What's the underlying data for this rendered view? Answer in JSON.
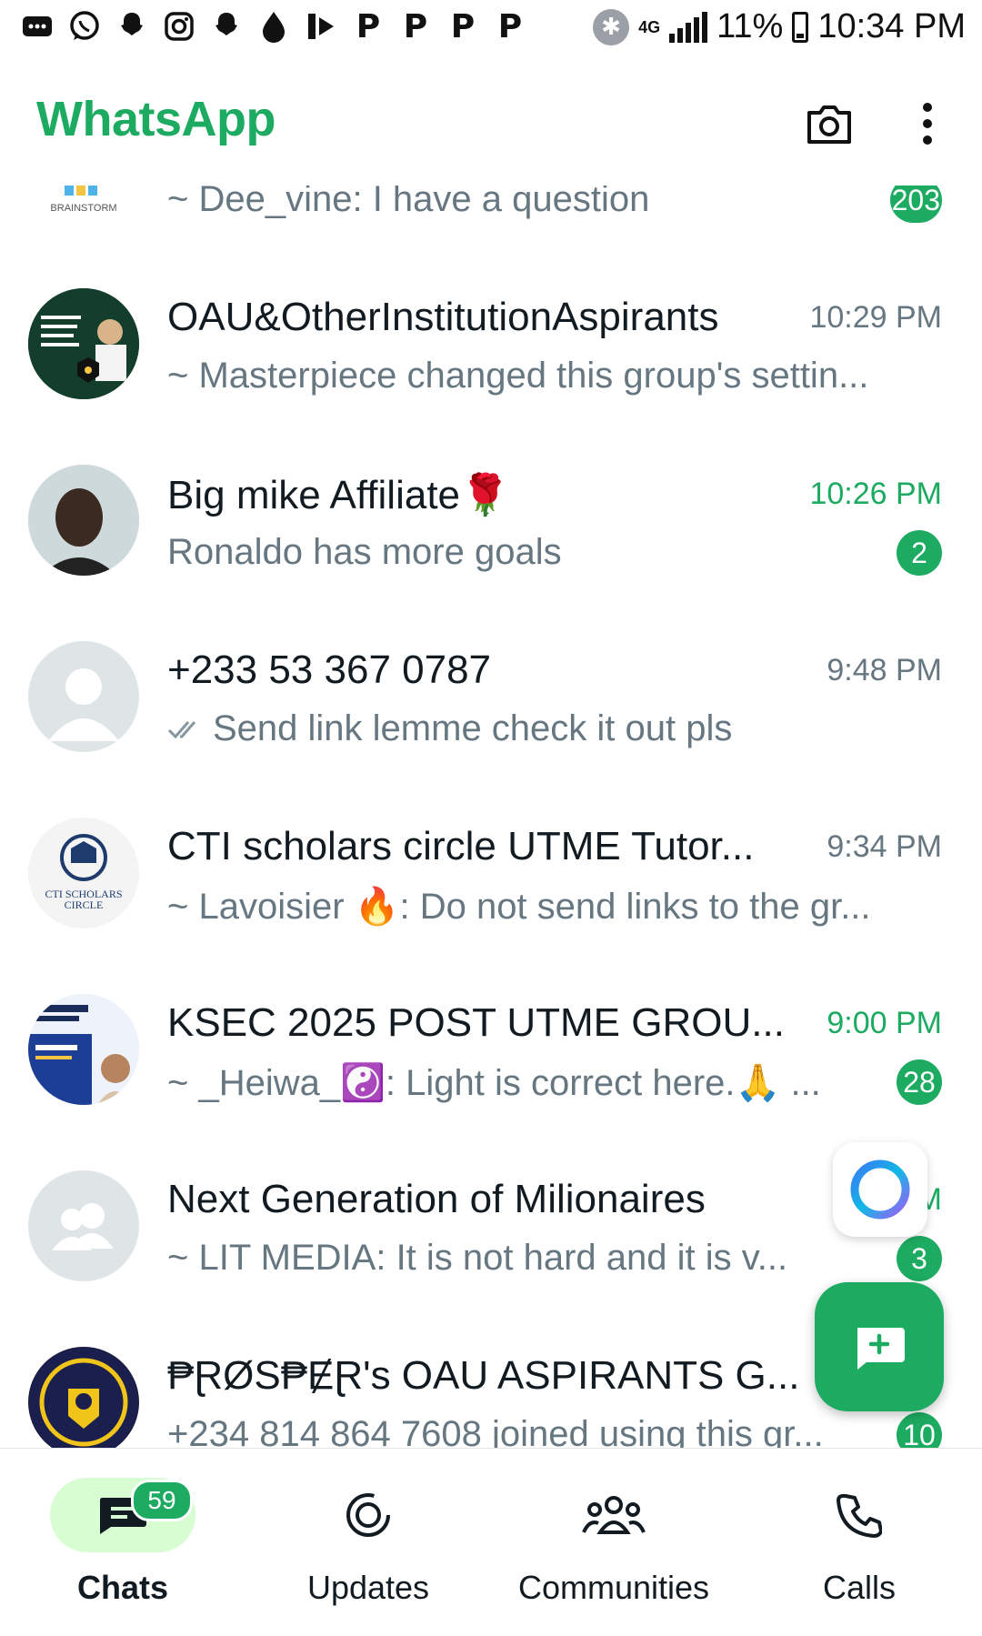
{
  "status_bar": {
    "battery": "11%",
    "time": "10:34 PM",
    "network": "4G",
    "notification_icons": [
      "messages-icon",
      "whatsapp-icon",
      "snapchat-icon",
      "instagram-icon",
      "snapchat-icon",
      "drop-icon",
      "bolt-icon",
      "p-icon",
      "p-icon",
      "p-icon",
      "p-icon"
    ]
  },
  "header": {
    "title": "WhatsApp"
  },
  "chats": [
    {
      "name": "",
      "preview": "~ Dee_vine: I have a question",
      "time": "",
      "unread": "203",
      "avatar_label": "BRAINSTORM"
    },
    {
      "name": "OAU&OtherInstitutionAspirants",
      "preview": "~ Masterpiece changed this group's settin...",
      "time": "10:29 PM",
      "unread": ""
    },
    {
      "name": "Big mike Affiliate🌹",
      "preview": "Ronaldo has more goals",
      "time": "10:26 PM",
      "unread": "2"
    },
    {
      "name": "+233 53 367 0787",
      "preview": "Send link lemme check it out pls",
      "time": "9:48 PM",
      "unread": ""
    },
    {
      "name": "CTI scholars circle UTME Tutor...",
      "preview": "~ Lavoisier 🔥: Do not send links to the gr...",
      "time": "9:34 PM",
      "unread": "",
      "avatar_label": "CTI SCHOLARS CIRCLE"
    },
    {
      "name": "KSEC 2025 POST UTME GROU...",
      "preview": "~ _Heiwa_☯️: Light is correct here.🙏 ...",
      "time": "9:00 PM",
      "unread": "28"
    },
    {
      "name": "Next Generation of Milionaires",
      "preview": "~ LIT MEDIA:  It is not hard and it is v...",
      "time": "8 M",
      "unread": "3"
    },
    {
      "name": "₱ⱤØS₱ɆⱤ's OAU ASPIRANTS G...",
      "preview": "+234 814 864 7608 joined using this gr...",
      "time": "",
      "unread": "10"
    }
  ],
  "bottom_nav": {
    "chats_label": "Chats",
    "chats_badge": "59",
    "updates_label": "Updates",
    "communities_label": "Communities",
    "calls_label": "Calls"
  },
  "colors": {
    "brand_green": "#1daa61",
    "active_tab_bg": "#d8fdd2",
    "muted_text": "#667781"
  }
}
